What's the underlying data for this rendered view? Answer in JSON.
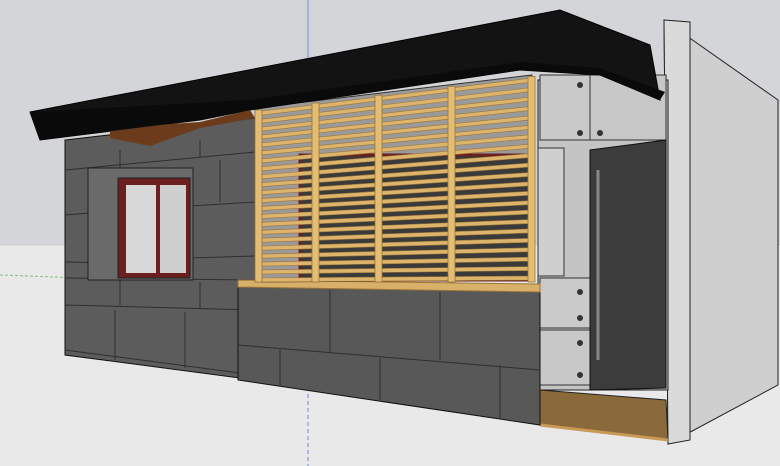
{
  "app": {
    "name": ""
  },
  "scene": {
    "sky_color": "#d3d5d8",
    "ground_color": "#e8e8e8",
    "axis_green": "#7fbf7f",
    "axis_blue": "#6f8fd8",
    "roof_color": "#111111",
    "soffit_color": "#6b3b1c",
    "stone_color": "#5a5a5a",
    "stone_dark": "#3f3f3f",
    "slat_color": "#d9b06a",
    "slat_edge": "#9b7538",
    "glass_color": "#d8d8d8",
    "frame_color": "#6b1f1f",
    "concrete_color": "#c9c9c9",
    "door_color": "#3b3b3b",
    "mat_color": "#8a6a3a"
  }
}
